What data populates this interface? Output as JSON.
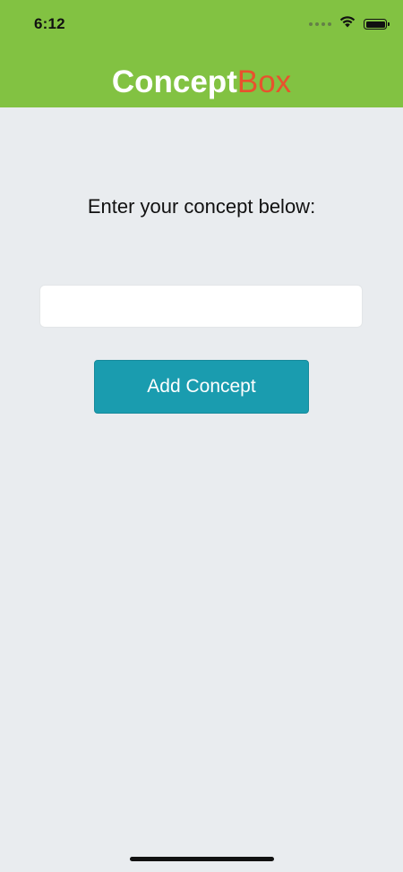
{
  "status_bar": {
    "time": "6:12",
    "icons": [
      "signal-dots-icon",
      "wifi-icon",
      "battery-icon"
    ]
  },
  "header": {
    "title_part1": "Concept",
    "title_part2": "Box",
    "colors": {
      "background": "#82c242",
      "title_part1": "#ffffff",
      "title_part2": "#e8522d"
    }
  },
  "main": {
    "prompt": "Enter your concept below:",
    "input": {
      "value": "",
      "placeholder": ""
    },
    "add_button_label": "Add Concept",
    "colors": {
      "background": "#e9ecef",
      "button": "#1a9caf"
    }
  }
}
